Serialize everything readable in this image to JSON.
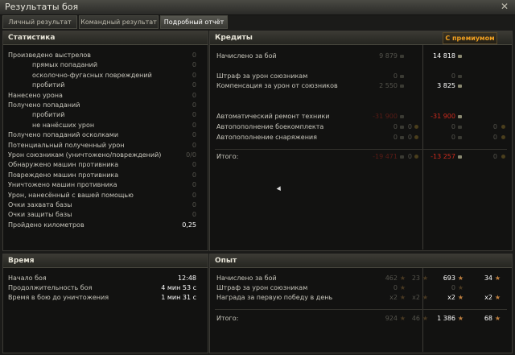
{
  "window": {
    "title": "Результаты боя"
  },
  "tabs": [
    {
      "label": "Личный результат"
    },
    {
      "label": "Командный результат"
    },
    {
      "label": "Подробный отчёт"
    }
  ],
  "stats": {
    "header": "Статистика",
    "rows": [
      {
        "label": "Произведено выстрелов",
        "value": "0"
      },
      {
        "label": "прямых попаданий",
        "value": "0"
      },
      {
        "label": "осколочно-фугасных повреждений",
        "value": "0"
      },
      {
        "label": "пробитий",
        "value": "0"
      },
      {
        "label": "Нанесено урона",
        "value": "0"
      },
      {
        "label": "Получено попаданий",
        "value": "0"
      },
      {
        "label": "пробитий",
        "value": "0"
      },
      {
        "label": "не нанёсших урон",
        "value": "0"
      },
      {
        "label": "Получено попаданий осколками",
        "value": "0"
      },
      {
        "label": "Потенциальный полученный урон",
        "value": "0"
      },
      {
        "label": "Урон союзникам (уничтожено/повреждений)",
        "value": "0/0"
      },
      {
        "label": "Обнаружено машин противника",
        "value": "0"
      },
      {
        "label": "Повреждено машин противника",
        "value": "0"
      },
      {
        "label": "Уничтожено машин противника",
        "value": "0"
      },
      {
        "label": "Урон, нанесённый с вашей помощью",
        "value": "0"
      },
      {
        "label": "Очки захвата базы",
        "value": "0"
      },
      {
        "label": "Очки защиты базы",
        "value": "0"
      },
      {
        "label": "Пройдено километров",
        "value": "0,25"
      }
    ]
  },
  "credits": {
    "header": "Кредиты",
    "premium_label": "С премиумом",
    "rows": [
      {
        "label": "Начислено за бой",
        "base": "9 879",
        "base_gold": "",
        "prem": "14 818",
        "prem_gold": ""
      },
      {
        "label": "Штраф за урон союзникам",
        "base": "0",
        "base_gold": "",
        "prem": "0",
        "prem_gold": ""
      },
      {
        "label": "Компенсация за урон от союзников",
        "base": "2 550",
        "base_gold": "",
        "prem": "3 825",
        "prem_gold": ""
      },
      {
        "label": "Автоматический ремонт техники",
        "base": "-31 900",
        "base_gold": "",
        "prem": "-31 900",
        "prem_gold": ""
      },
      {
        "label": "Автопополнение боекомплекта",
        "base": "0",
        "base_gold": "0",
        "prem": "0",
        "prem_gold": "0"
      },
      {
        "label": "Автопополнение снаряжения",
        "base": "0",
        "base_gold": "0",
        "prem": "0",
        "prem_gold": "0"
      },
      {
        "label": "Итого:",
        "base": "-19 471",
        "base_gold": "0",
        "prem": "-13 257",
        "prem_gold": "0"
      }
    ]
  },
  "time": {
    "header": "Время",
    "rows": [
      {
        "label": "Начало боя",
        "value": "12:48"
      },
      {
        "label": "Продолжительность боя",
        "value": "4 мин 53 с"
      },
      {
        "label": "Время в бою до уничтожения",
        "value": "1 мин 31 с"
      }
    ]
  },
  "xp": {
    "header": "Опыт",
    "rows": [
      {
        "label": "Начислено за бой",
        "base": "462",
        "base_free": "23",
        "prem": "693",
        "prem_free": "34"
      },
      {
        "label": "Штраф за урон союзникам",
        "base": "0",
        "base_free": "",
        "prem": "0",
        "prem_free": ""
      },
      {
        "label": "Награда за первую победу в день",
        "base": "x2",
        "base_free": "x2",
        "prem": "x2",
        "prem_free": "x2"
      },
      {
        "label": "Итого:",
        "base": "924",
        "base_free": "46",
        "prem": "1 386",
        "prem_free": "68"
      }
    ]
  },
  "icons": {
    "credits": "credit-coin-icon",
    "gold": "gold-coin-icon",
    "xp": "xp-star-icon",
    "free_xp": "free-xp-star-icon"
  }
}
